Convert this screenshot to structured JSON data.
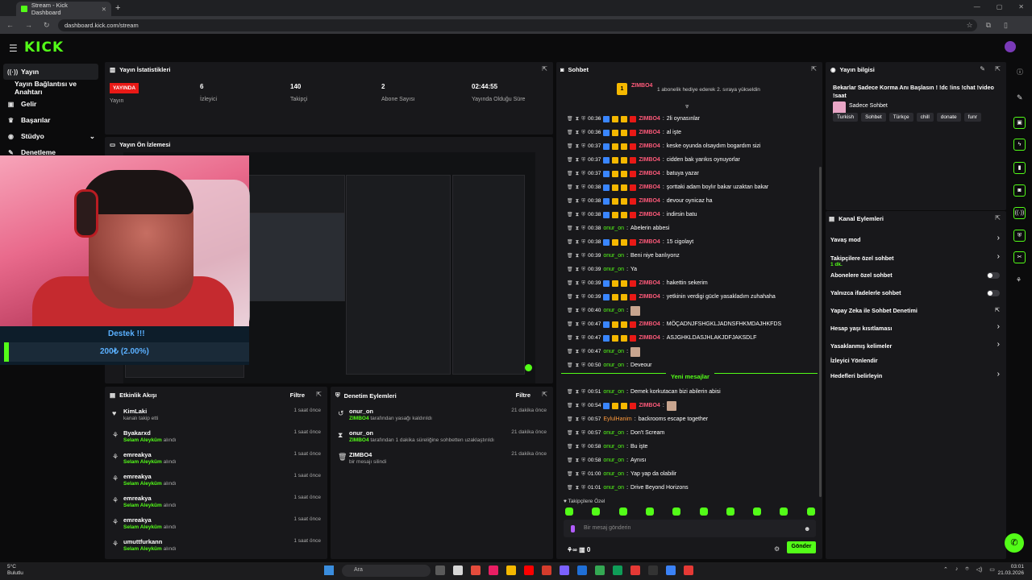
{
  "browser": {
    "tab_title": "Stream - Kick Dashboard",
    "url": "dashboard.kick.com/stream"
  },
  "brand": {
    "logo": "KICK",
    "accent": "#53fc18"
  },
  "sidebar": {
    "items": [
      {
        "label": "Yayın",
        "icon": "broadcast-icon"
      },
      {
        "label": "Yayın Bağlantısı ve Anahtarı",
        "icon": ""
      },
      {
        "label": "Gelir",
        "icon": "money-icon"
      },
      {
        "label": "Başarılar",
        "icon": "trophy-icon"
      },
      {
        "label": "Stüdyo",
        "icon": "studio-icon"
      },
      {
        "label": "Denetleme",
        "icon": "moderation-icon"
      }
    ]
  },
  "stats": {
    "title": "Yayın İstatistikleri",
    "items": [
      {
        "value": "YAYINDA",
        "label": "Yayın"
      },
      {
        "value": "6",
        "label": "İzleyici"
      },
      {
        "value": "140",
        "label": "Takipçi"
      },
      {
        "value": "2",
        "label": "Abone Sayısı"
      },
      {
        "value": "02:44:55",
        "label": "Yayında Olduğu Süre"
      }
    ]
  },
  "preview": {
    "title": "Yayın Ön İzlemesi"
  },
  "donation": {
    "title": "Destek !!!",
    "amount": "200₺ (2.00%)",
    "progress_pct": 2
  },
  "activity": {
    "title": "Etkinlik Akışı",
    "filter": "Filtre",
    "rows": [
      {
        "name": "KimLaki",
        "sub": "kanalı takip etti",
        "highlight": "",
        "time": "1 saat önce",
        "icon": "heart-icon"
      },
      {
        "name": "Byakarxd",
        "sub": "alındı",
        "highlight": "Selam Aleyküm",
        "time": "1 saat önce",
        "icon": "reward-icon"
      },
      {
        "name": "emreakya",
        "sub": "alındı",
        "highlight": "Selam Aleyküm",
        "time": "1 saat önce",
        "icon": "reward-icon"
      },
      {
        "name": "emreakya",
        "sub": "alındı",
        "highlight": "Selam Aleyküm",
        "time": "1 saat önce",
        "icon": "reward-icon"
      },
      {
        "name": "emreakya",
        "sub": "alındı",
        "highlight": "Selam Aleyküm",
        "time": "1 saat önce",
        "icon": "reward-icon"
      },
      {
        "name": "emreakya",
        "sub": "alındı",
        "highlight": "Selam Aleyküm",
        "time": "1 saat önce",
        "icon": "reward-icon"
      },
      {
        "name": "umuttfurkann",
        "sub": "alındı",
        "highlight": "Selam Aleyküm",
        "time": "1 saat önce",
        "icon": "reward-icon"
      }
    ]
  },
  "moderation": {
    "title": "Denetim Eylemleri",
    "filter": "Filtre",
    "rows": [
      {
        "name": "onur_on",
        "highlight": "ZIMBO4",
        "sub": "tarafından yasağı kaldırıldı",
        "time": "21 dakika önce",
        "icon": "undo-icon"
      },
      {
        "name": "onur_on",
        "highlight": "ZIMBO4",
        "sub": "tarafından 1 dakika süreliğine sohbetten uzaklaştırıldı",
        "time": "21 dakika önce",
        "icon": "hourglass-icon"
      },
      {
        "name": "ZIMBO4",
        "highlight": "",
        "sub": "bir mesajı silindi",
        "time": "21 dakika önce",
        "icon": "trash-icon"
      }
    ]
  },
  "chat": {
    "title": "Sohbet",
    "pinned_user": "ZIMBO4",
    "pinned_text": "1 abonelik hediye ederek 2. sıraya yükseldin",
    "messages": [
      {
        "time": "00:36",
        "user": "ZIMBO4",
        "text": "2li oynasınlar",
        "kind": "red"
      },
      {
        "time": "00:36",
        "user": "ZIMBO4",
        "text": "al işte",
        "kind": "red"
      },
      {
        "time": "00:37",
        "user": "ZIMBO4",
        "text": "keske oyunda olsaydım bogardım sizi",
        "kind": "red"
      },
      {
        "time": "00:37",
        "user": "ZIMBO4",
        "text": "cidden bak yarıkıs oynuyorlar",
        "kind": "red"
      },
      {
        "time": "00:37",
        "user": "ZIMBO4",
        "text": "batuya yazar",
        "kind": "red"
      },
      {
        "time": "00:38",
        "user": "ZIMBO4",
        "text": "şorttaki adam boylır bakar uzaktan bakar",
        "kind": "red"
      },
      {
        "time": "00:38",
        "user": "ZIMBO4",
        "text": "devour oynicaz ha",
        "kind": "red"
      },
      {
        "time": "00:38",
        "user": "ZIMBO4",
        "text": "indirsin batu",
        "kind": "red"
      },
      {
        "time": "00:38",
        "user": "onur_on",
        "text": "Abelerin abbesi",
        "kind": "green"
      },
      {
        "time": "00:38",
        "user": "ZIMBO4",
        "text": "15 cigolayt",
        "kind": "red"
      },
      {
        "time": "00:39",
        "user": "onur_on",
        "text": "Beni niye banlıyonz",
        "kind": "green"
      },
      {
        "time": "00:39",
        "user": "onur_on",
        "text": "Ya",
        "kind": "green"
      },
      {
        "time": "00:39",
        "user": "ZIMBO4",
        "text": "hakettin sekerim",
        "kind": "red"
      },
      {
        "time": "00:39",
        "user": "ZIMBO4",
        "text": "yetkinin verdigi gücle yasakladım zuhahaha",
        "kind": "red"
      },
      {
        "time": "00:40",
        "user": "onur_on",
        "text": "",
        "kind": "green"
      },
      {
        "time": "00:47",
        "user": "ZIMBO4",
        "text": "MÖÇADNJFSHGKLJADNSFHKMDAJHKFDS",
        "kind": "red"
      },
      {
        "time": "00:47",
        "user": "ZIMBO4",
        "text": "ASJGHKLDASJHLAKJDFJAKSDLF",
        "kind": "red"
      },
      {
        "time": "00:47",
        "user": "onur_on",
        "text": "",
        "kind": "green"
      },
      {
        "time": "00:50",
        "user": "onur_on",
        "text": "Deveour",
        "kind": "green"
      }
    ],
    "new_label": "Yeni mesajlar",
    "new_messages": [
      {
        "time": "00:51",
        "user": "onur_on",
        "text": "Demek korkutacan bizi abilerin abisi",
        "kind": "green"
      },
      {
        "time": "00:54",
        "user": "ZIMBO4",
        "text": "",
        "kind": "red"
      },
      {
        "time": "00:57",
        "user": "EylulHanim",
        "text": "backrooms escape together",
        "kind": "orange"
      },
      {
        "time": "00:57",
        "user": "onur_on",
        "text": "Don't Scream",
        "kind": "green"
      },
      {
        "time": "00:58",
        "user": "onur_on",
        "text": "Bu işte",
        "kind": "green"
      },
      {
        "time": "00:58",
        "user": "onur_on",
        "text": "Aynısı",
        "kind": "green"
      },
      {
        "time": "01:00",
        "user": "onur_on",
        "text": "Yap yap da olabilir",
        "kind": "green"
      },
      {
        "time": "01:01",
        "user": "onur_on",
        "text": "Drive Beyond Horizons",
        "kind": "green"
      }
    ],
    "followers_only": "Takipçilere Özel",
    "input_placeholder": "Bir mesaj gönderin",
    "points": "0",
    "send_label": "Gönder"
  },
  "stream_info": {
    "title": "Yayın bilgisi",
    "stream_title": "Bekarlar Sadece Korma Anı Başlasın ! !dc !ins !chat !video !saat",
    "category": "Sadece Sohbet",
    "tags": [
      "Turkish",
      "Sohbet",
      "Türkçe",
      "chill",
      "donate",
      "funr"
    ]
  },
  "channel_actions": {
    "title": "Kanal Eylemleri",
    "items": [
      {
        "label": "Yavaş mod",
        "sub": "",
        "control": "chevron"
      },
      {
        "label": "Takipçilere özel sohbet",
        "sub": "1 dk.",
        "control": "chevron"
      },
      {
        "label": "Abonelere özel sohbet",
        "sub": "",
        "control": "toggle"
      },
      {
        "label": "Yalnızca ifadelerle sohbet",
        "sub": "",
        "control": "toggle"
      },
      {
        "label": "Yapay Zeka ile Sohbet Denetimi",
        "sub": "",
        "control": "external"
      },
      {
        "label": "Hesap yaşı kısıtlaması",
        "sub": "",
        "control": "chevron"
      },
      {
        "label": "Yasaklanmış kelimeler",
        "sub": "",
        "control": "chevron"
      },
      {
        "label": "İzleyici Yönlendir",
        "sub": "",
        "control": ""
      },
      {
        "label": "Hedefleri belirleyin",
        "sub": "",
        "control": "chevron"
      }
    ]
  },
  "taskbar": {
    "temp": "5°C",
    "weather": "Bulutlu",
    "search": "Ara",
    "time": "03:01",
    "date": "21.03.2026"
  }
}
